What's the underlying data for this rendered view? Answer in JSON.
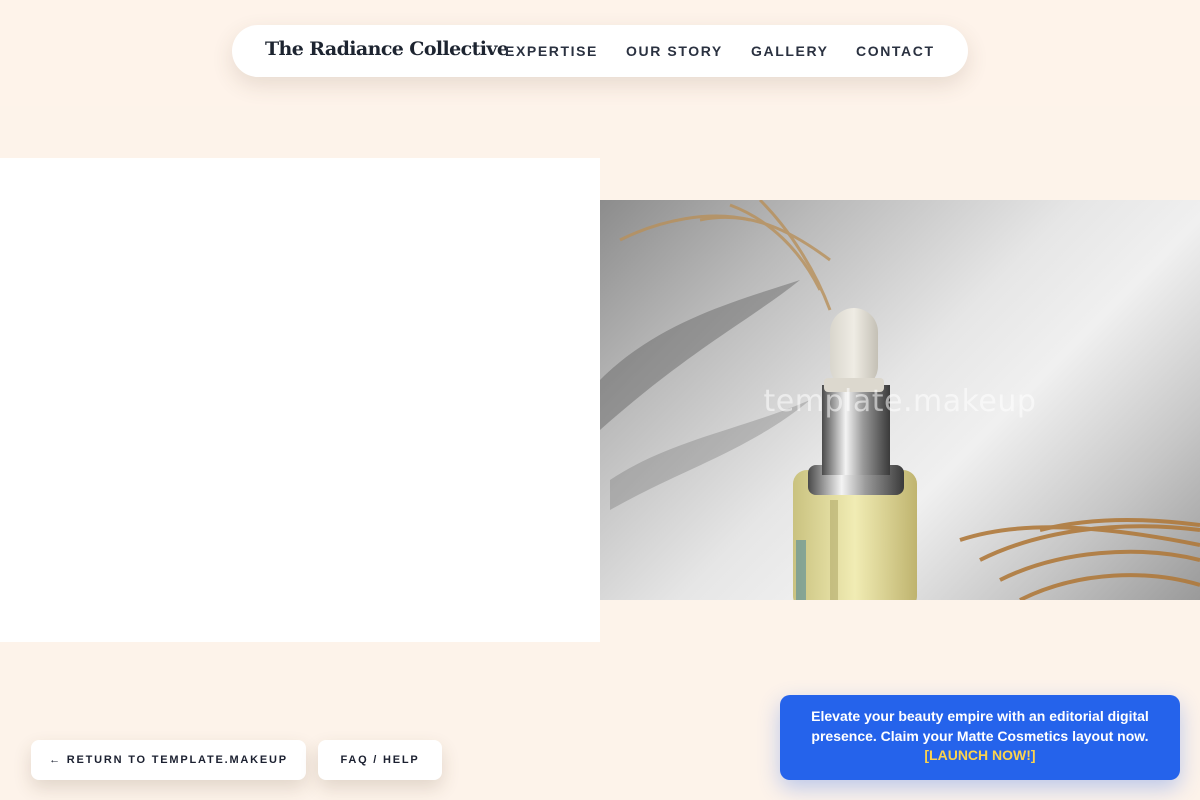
{
  "nav": {
    "brand": "The Radiance Collective",
    "links": [
      "EXPERTISE",
      "OUR STORY",
      "GALLERY",
      "CONTACT"
    ]
  },
  "hero": {
    "watermark": "template.makeup",
    "image_description_icon": "serum-dropper-bottle-photo"
  },
  "footer_buttons": {
    "return_label": "← RETURN TO TEMPLATE.MAKEUP",
    "faq_label": "FAQ / HELP"
  },
  "promo": {
    "text": "Elevate your beauty empire with an editorial digital presence. Claim your Matte Cosmetics layout now.",
    "cta": "[LAUNCH NOW!]"
  },
  "colors": {
    "page_background": "#fdf3ea",
    "promo_background": "#2563eb",
    "promo_cta": "#fcd34d",
    "text_dark": "#1d2430"
  }
}
